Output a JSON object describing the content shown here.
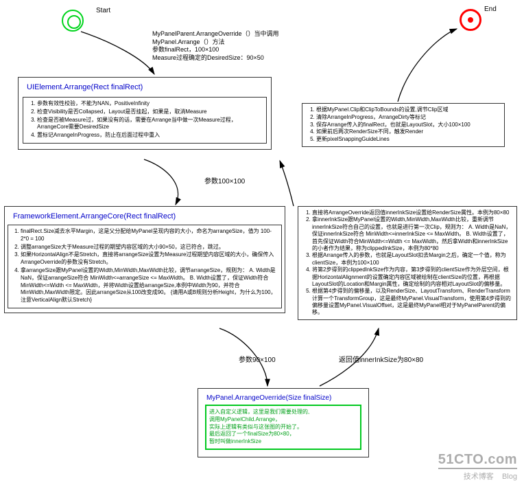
{
  "labels": {
    "start": "Start",
    "end": "End"
  },
  "note_top": [
    "MyPanelParent.ArrangeOverride（）当中调用",
    "MyPanel.Arrange（）方法",
    "参数finalRect，100×100",
    "Measure过程确定的DesiredSize：90×50"
  ],
  "box1": {
    "title": "UIElement.Arrange(Rect finalRect)",
    "left": [
      "参数有效性校验，不能为NAN，PositiveInfinity",
      "检查Visibility是否Collapsed，Layout是否挂起，如果是，取消Measure",
      "检查是否被Measure过，如果没有的话，需要在Arrange当中做一次Measure过程，ArrangeCore需要DesiredSize",
      "置标记ArrangeInProgress，防止在后面过程中重入"
    ],
    "right": [
      "根据MyPanel.Clip和ClipToBounds的设置,调节Clip区域",
      "清除ArrangeInProgress，ArrangeDirty等标记",
      "保存Arrange传入的finalRect，也就是LayoutSlot，大小100×100",
      "如果前后两次RenderSize不同，触发Render",
      "更新pixelSnappingGuideLines"
    ]
  },
  "box2": {
    "title": "FrameworkElement.ArrangeCore(Rect finalRect)",
    "left": [
      "finalRect.Size减去水平Margin，这是父分配给MyPanel呈现内容的大小，命名为arrangeSize，值为 100-2*0 = 100",
      "调整arrangeSize大于Measure过程的期望内容区域的大小90×50，这已符合，跳过。",
      "如果HorizontalAlign不是Stretch，直接将arrangeSize设置为Measure过程期望内容区域的大小，确保传入ArrangeOverride的参数没有Stretch。",
      "拿arrangeSize跟MyPanel设置的Width,MinWidth,MaxWidth比较，调节arrangeSize，规则为： A. Width是NaN，保证arrangeSize符合 MinWidth<=arrangeSize <= MaxWidth。 B. Width设置了，保证Width符合MinWidth<=Width <= MaxWidth，并将Width设置给arrangeSize,本例中Width为90，并符合MinWidth,MaxWidth限定。因此arrangeSize从100改变成90。 {请用A或B规则分析Height，为什么为100，注意VerticalAlign默认Stretch}"
    ],
    "right": [
      "直接将ArrangeOverride返回值innerInkSize设置给RenderSize属性。本例为80×80",
      "拿innerInkSize跟MyPanel设置的Width,MinWidth,MaxWidth比较，重新调节innerInkSize符合自己的设置，也就是进行第一次Clip，规则为： A. Width是NaN，保证innerInkSize符合 MinWidth<=innerInkSize <= MaxWidth。 B. Width设置了，首先保证Width符合MinWidth<=Width <= MaxWidth，然后拿Width和innerInkSize的小者作为结果，称为clippedInkSize，本例为80*80",
      "根据Arrange传入的参数，也就是LayoutSlot扣去Margin之后，确定一个值，称为clientSize，本例为100×100",
      "将第2步得到的clippedInkSize作为内容，第3步得到的clientSize作为外层空间，根据HorizontalAlignment的设置确定内容区域被绘制在clientSize的位置，再根据LayoutSlot的Location和Margin属性，确定绘制的内容相对LayoutSlot的偏移量。",
      "根据第4步得到的偏移量，以及RenderSize、LayoutTransform、RenderTransform计算一个TransformGroup，这是最终MyPanel.VisualTransform，使用第4步得到的偏移量设置MyPanel.VisualOffset，这是最终MyPanel相对于MyPanelParent的偏移。"
    ]
  },
  "box3": {
    "title": "MyPanel.ArrangeOverride(Size finalSize)",
    "body": [
      "进入自定义逻辑，这里是我们需要处理的,",
      "调用MyPanelChild.Arrange，",
      "实际上逻辑有类似与这张图的开始了。",
      "最后返回了一个finalSize为80×80，",
      "暂时叫做innerInkSize"
    ]
  },
  "params": {
    "p1": "参数100×100",
    "p2": "参数90×100",
    "p3": "返回值innerInkSize为80×80"
  },
  "watermark": {
    "line1": "51CTO.com",
    "line2_a": "技术博客",
    "line2_b": "Blog"
  }
}
